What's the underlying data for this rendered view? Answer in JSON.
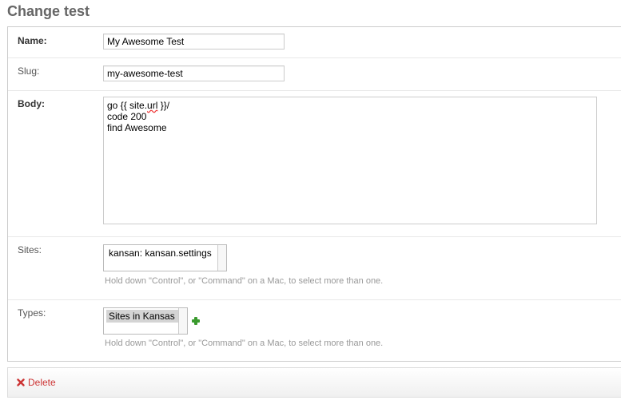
{
  "page": {
    "title": "Change test"
  },
  "form": {
    "name": {
      "label": "Name:",
      "value": "My Awesome Test"
    },
    "slug": {
      "label": "Slug:",
      "value": "my-awesome-test"
    },
    "body": {
      "label": "Body:",
      "lines": [
        "go {{ site.",
        "url",
        " }}/",
        "code 200",
        "find Awesome"
      ]
    },
    "sites": {
      "label": "Sites:",
      "options": [
        {
          "text": "kansan: kansan.settings",
          "selected": false
        }
      ],
      "help": "Hold down \"Control\", or \"Command\" on a Mac, to select more than one."
    },
    "types": {
      "label": "Types:",
      "options": [
        {
          "text": "Sites in Kansas",
          "selected": true
        }
      ],
      "add_icon": "plus-icon",
      "help": "Hold down \"Control\", or \"Command\" on a Mac, to select more than one."
    }
  },
  "actions": {
    "delete_label": "Delete",
    "delete_icon": "x-icon",
    "delete_color": "#cc3434"
  },
  "colors": {
    "add_icon": "#3a9a2e",
    "help_text": "#999999"
  }
}
